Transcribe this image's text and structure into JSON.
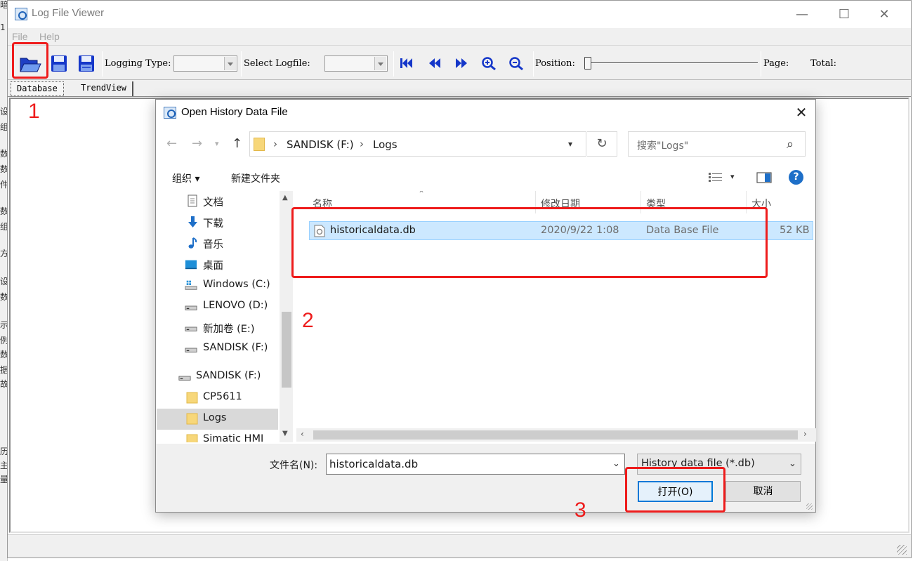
{
  "app": {
    "title": "Log File Viewer",
    "menu": [
      "File",
      "Help"
    ],
    "toolbar": {
      "logging_type_label": "Logging Type:",
      "select_logfile_label": "Select Logfile:",
      "position_label": "Position:",
      "page_label": "Page:",
      "total_label": "Total:",
      "position_value": 0
    },
    "tabs": [
      "Database",
      "TrendView"
    ]
  },
  "annotations": [
    "1",
    "2",
    "3"
  ],
  "background_window_glyphs": [
    "暗",
    "1",
    "设",
    "组",
    "数",
    "数",
    "件",
    "数",
    "组",
    "方",
    "设",
    "数",
    "示",
    "例",
    "数",
    "据",
    "故",
    "历",
    "主",
    "量"
  ],
  "dialog": {
    "title": "Open History Data File",
    "breadcrumb": [
      "SANDISK (F:)",
      "Logs"
    ],
    "search_placeholder": "搜索\"Logs\"",
    "commands": {
      "organize": "组织 ▾",
      "new_folder": "新建文件夹"
    },
    "nav_items": [
      {
        "label": "文档",
        "icon": "document-icon"
      },
      {
        "label": "下载",
        "icon": "download-icon"
      },
      {
        "label": "音乐",
        "icon": "music-icon"
      },
      {
        "label": "桌面",
        "icon": "desktop-icon"
      },
      {
        "label": "Windows (C:)",
        "icon": "windows-drive-icon"
      },
      {
        "label": "LENOVO (D:)",
        "icon": "drive-icon"
      },
      {
        "label": "新加卷 (E:)",
        "icon": "drive-icon"
      },
      {
        "label": "SANDISK (F:)",
        "icon": "drive-icon"
      },
      {
        "label": "SANDISK (F:)",
        "icon": "drive-icon"
      },
      {
        "label": "CP5611",
        "icon": "folder-icon"
      },
      {
        "label": "Logs",
        "icon": "folder-icon"
      },
      {
        "label": "Simatic HMI",
        "icon": "folder-icon"
      }
    ],
    "columns": [
      "名称",
      "修改日期",
      "类型",
      "大小"
    ],
    "files": [
      {
        "name": "historicaldata.db",
        "modified": "2020/9/22 1:08",
        "type": "Data Base File",
        "size": "52 KB"
      }
    ],
    "filename_label": "文件名(N):",
    "filename_value": "historicaldata.db",
    "filter": "History data file (*.db)",
    "open_label": "打开(O)",
    "cancel_label": "取消"
  },
  "colors": {
    "accent": "#0078d7",
    "annotation": "#ee1c1c",
    "selection": "#cce8ff",
    "toolbar_icon": "#1537c9"
  }
}
